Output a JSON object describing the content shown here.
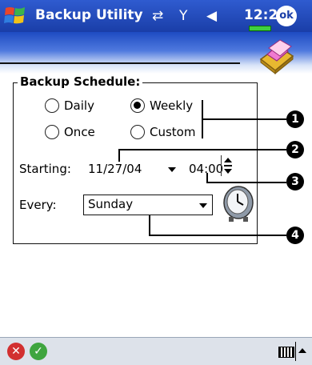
{
  "titlebar": {
    "title": "Backup Utility",
    "time": "12:22",
    "ok_label": "ok",
    "icons": [
      "start-menu-icon",
      "connectivity-icon",
      "signal-icon",
      "volume-icon",
      "battery-icon"
    ]
  },
  "group": {
    "title": "Backup Schedule:",
    "options": {
      "daily": "Daily",
      "weekly": "Weekly",
      "once": "Once",
      "custom": "Custom"
    },
    "selected": "Weekly"
  },
  "starting": {
    "label": "Starting:",
    "date": "11/27/04",
    "time": "04:00"
  },
  "every": {
    "label": "Every:",
    "value": "Sunday"
  },
  "callouts": [
    "1",
    "2",
    "3",
    "4"
  ],
  "colors": {
    "titlebar": "#1a3ea8",
    "bottombar": "#dde2ea"
  }
}
